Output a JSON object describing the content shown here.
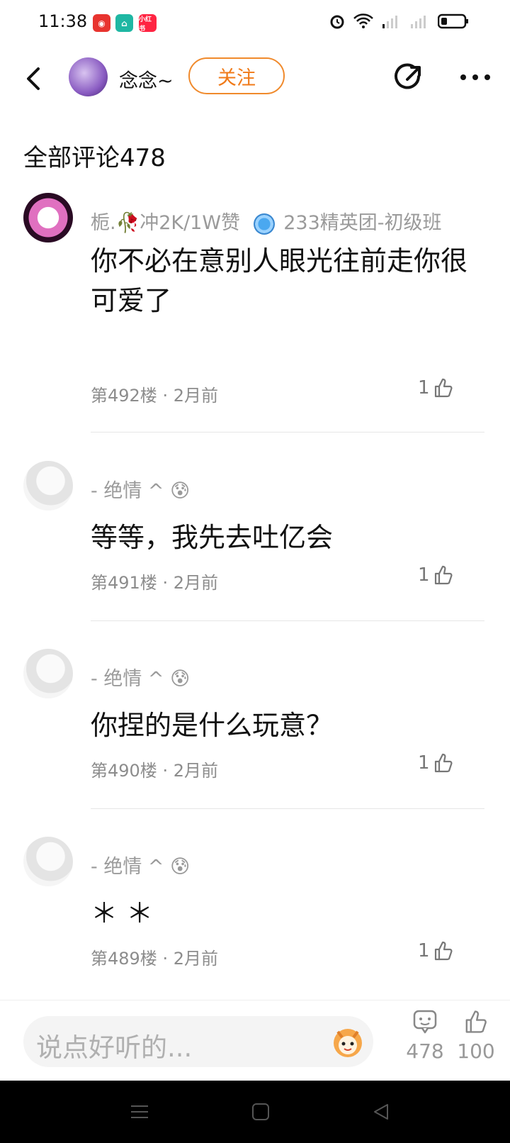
{
  "status": {
    "time": "11:38",
    "apps": [
      "网易云",
      "家",
      "小红书"
    ]
  },
  "header": {
    "name": "念念~",
    "follow_label": "关注"
  },
  "section_title": "全部评论478",
  "comments": [
    {
      "user": "栀.🥀冲2K/1W赞",
      "badge": "233精英团-初级班",
      "text": "你不必在意别人眼光往前走你很可爱了",
      "floor": "第492楼",
      "time": "2月前",
      "likes": "1"
    },
    {
      "user": "- 绝情 ^ 😰",
      "text": "等等，我先去吐亿会",
      "floor": "第491楼",
      "time": "2月前",
      "likes": "1"
    },
    {
      "user": "- 绝情 ^ 😰",
      "text": "你捏的是什么玩意？",
      "floor": "第490楼",
      "time": "2月前",
      "likes": "1"
    },
    {
      "user": "- 绝情 ^ 😰",
      "text": "＊ ＊",
      "floor": "第489楼",
      "time": "2月前",
      "likes": "1"
    }
  ],
  "bottom": {
    "placeholder": "说点好听的...",
    "comment_count": "478",
    "like_count": "100"
  },
  "colors": {
    "accent": "#f07a18",
    "muted": "#9a9a9a"
  }
}
